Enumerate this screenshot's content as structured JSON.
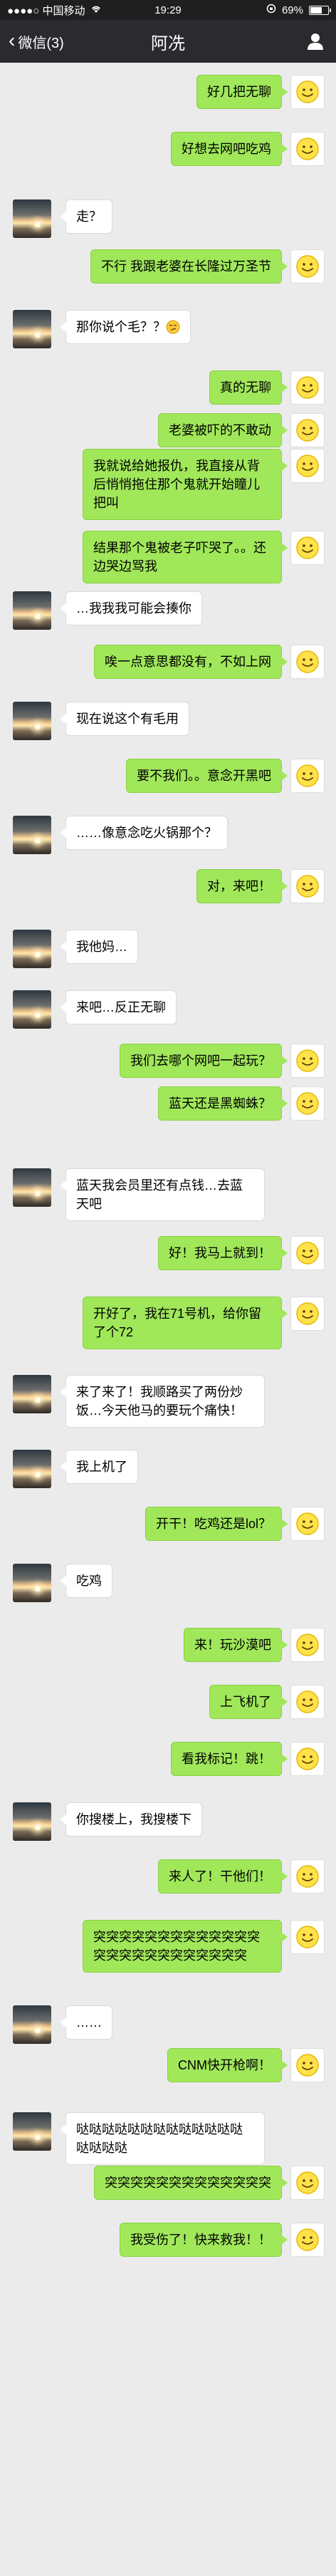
{
  "status_bar": {
    "carrier": "●●●●○ 中国移动",
    "time": "19:29",
    "battery": "69%"
  },
  "nav": {
    "back_label": "微信(3)",
    "title": "阿冼"
  },
  "messages": [
    {
      "from": "me",
      "text": "好几把无聊"
    },
    {
      "from": "me",
      "text": "好想去网吧吃鸡"
    },
    {
      "from": "them",
      "text": "走？"
    },
    {
      "from": "me",
      "text": "不行 我跟老婆在长隆过万圣节"
    },
    {
      "from": "them",
      "text": "那你说个毛？？",
      "emoji": "smirk-emoji"
    },
    {
      "from": "me",
      "text": "真的无聊"
    },
    {
      "from": "me",
      "text": "老婆被吓的不敢动"
    },
    {
      "from": "me",
      "text": "我就说给她报仇，我直接从背后悄悄拖住那个鬼就开始瞳儿把叫"
    },
    {
      "from": "me",
      "text": "结果那个鬼被老子吓哭了。。还边哭边骂我"
    },
    {
      "from": "them",
      "text": "…我我我可能会揍你"
    },
    {
      "from": "me",
      "text": "唉一点意思都没有，不如上网"
    },
    {
      "from": "them",
      "text": "现在说这个有毛用"
    },
    {
      "from": "me",
      "text": "要不我们。。意念开黑吧"
    },
    {
      "from": "them",
      "text": "……像意念吃火锅那个？"
    },
    {
      "from": "me",
      "text": "对，来吧！"
    },
    {
      "from": "them",
      "text": "我他妈…"
    },
    {
      "from": "them",
      "text": "来吧…反正无聊"
    },
    {
      "from": "me",
      "text": "我们去哪个网吧一起玩？"
    },
    {
      "from": "me",
      "text": "蓝天还是黑蜘蛛？"
    },
    {
      "from": "them",
      "text": "蓝天我会员里还有点钱…去蓝天吧"
    },
    {
      "from": "me",
      "text": "好！我马上就到！"
    },
    {
      "from": "me",
      "text": "开好了，我在71号机，给你留了个72"
    },
    {
      "from": "them",
      "text": "来了来了！我顺路买了两份炒饭…今天他马的要玩个痛快！"
    },
    {
      "from": "them",
      "text": "我上机了"
    },
    {
      "from": "me",
      "text": "开干！吃鸡还是lol？"
    },
    {
      "from": "them",
      "text": "吃鸡"
    },
    {
      "from": "me",
      "text": "来！玩沙漠吧"
    },
    {
      "from": "me",
      "text": "上飞机了"
    },
    {
      "from": "me",
      "text": "看我标记！跳！"
    },
    {
      "from": "them",
      "text": "你搜楼上，我搜楼下"
    },
    {
      "from": "me",
      "text": "来人了！干他们！"
    },
    {
      "from": "me",
      "text": "突突突突突突突突突突突突突突突突突突突突突突突突突"
    },
    {
      "from": "them",
      "text": "……"
    },
    {
      "from": "me",
      "text": "CNM快开枪啊！"
    },
    {
      "from": "them",
      "text": "哒哒哒哒哒哒哒哒哒哒哒哒哒哒哒哒哒"
    },
    {
      "from": "me",
      "text": "突突突突突突突突突突突突突"
    },
    {
      "from": "me",
      "text": "我受伤了！快来救我！！"
    }
  ]
}
